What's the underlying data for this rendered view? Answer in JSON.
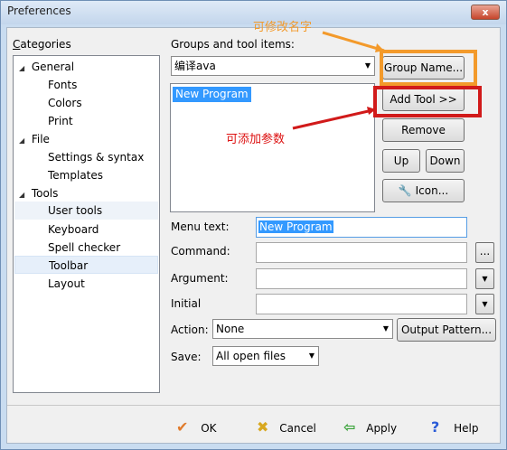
{
  "window": {
    "title": "Preferences",
    "close_glyph": "x"
  },
  "categories": {
    "label": "Categories",
    "items": [
      {
        "label": "General",
        "expanded": true
      },
      {
        "label": "Fonts"
      },
      {
        "label": "Colors"
      },
      {
        "label": "Print"
      },
      {
        "label": "File",
        "expanded": true
      },
      {
        "label": "Settings & syntax"
      },
      {
        "label": "Templates"
      },
      {
        "label": "Tools",
        "expanded": true
      },
      {
        "label": "User tools"
      },
      {
        "label": "Keyboard"
      },
      {
        "label": "Spell checker"
      },
      {
        "label": "Toolbar"
      },
      {
        "label": "Layout"
      }
    ]
  },
  "groups": {
    "label": "Groups and tool items:",
    "selected_group": "编译ava",
    "list_items": [
      "New Program"
    ]
  },
  "buttons": {
    "group_name": "Group Name...",
    "add_tool": "Add Tool >>",
    "remove": "Remove",
    "up": "Up",
    "down": "Down",
    "icon": "Icon...",
    "output_pattern": "Output Pattern...",
    "ellipsis": "..."
  },
  "fields": {
    "menu_text_label": "Menu text:",
    "menu_text_value": "New Program",
    "command_label": "Command:",
    "argument_label": "Argument:",
    "initial_label": "Initial",
    "action_label": "Action:",
    "action_value": "None",
    "save_label": "Save:",
    "save_value": "All open files"
  },
  "footer": {
    "ok": "OK",
    "cancel": "Cancel",
    "apply": "Apply",
    "help": "Help"
  },
  "annotations": {
    "rename": "可修改名字",
    "add_params": "可添加参数"
  },
  "colors": {
    "orange_annotation": "#f39a2b",
    "red_annotation": "#d11a1a",
    "selection": "#3399ff"
  }
}
